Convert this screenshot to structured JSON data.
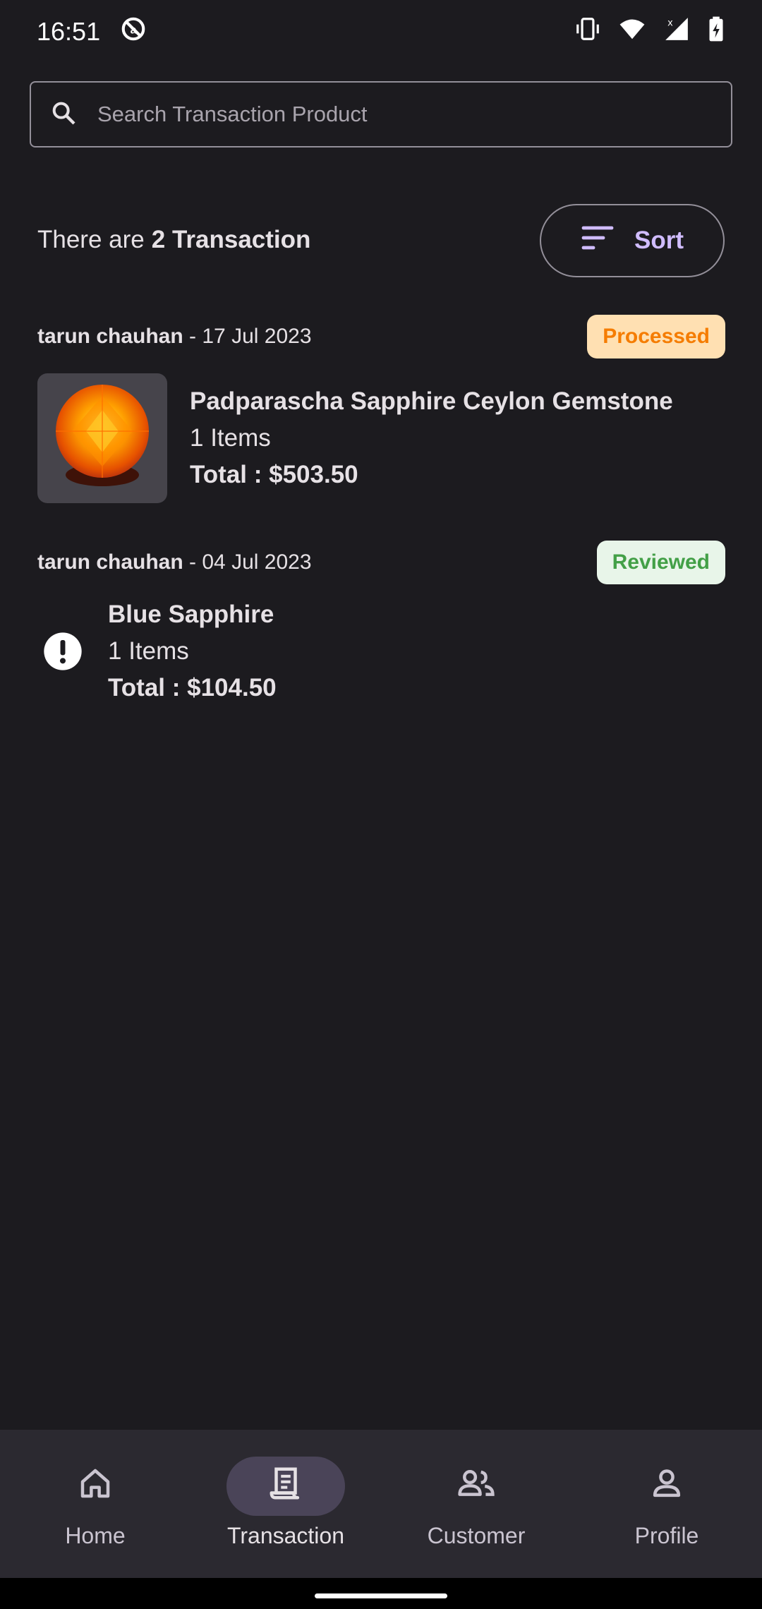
{
  "status_bar": {
    "time": "16:51"
  },
  "search": {
    "placeholder": "Search Transaction Product"
  },
  "summary": {
    "prefix": "There are",
    "count_text": "2 Transaction"
  },
  "sort": {
    "label": "Sort"
  },
  "transactions": [
    {
      "customer": "tarun chauhan",
      "separator": " - ",
      "date": "17 Jul 2023",
      "status": "Processed",
      "product": "Padparascha Sapphire Ceylon Gemstone",
      "items": "1 Items",
      "total": "Total : $503.50",
      "has_image": true
    },
    {
      "customer": "tarun chauhan",
      "separator": " - ",
      "date": "04 Jul 2023",
      "status": "Reviewed",
      "product": "Blue Sapphire",
      "items": "1 Items",
      "total": "Total : $104.50",
      "has_image": false
    }
  ],
  "nav": [
    {
      "label": "Home",
      "icon": "home-icon",
      "active": false
    },
    {
      "label": "Transaction",
      "icon": "receipt-icon",
      "active": true
    },
    {
      "label": "Customer",
      "icon": "people-icon",
      "active": false
    },
    {
      "label": "Profile",
      "icon": "person-icon",
      "active": false
    }
  ],
  "colors": {
    "background": "#1c1b1f",
    "accent": "#d0bcff",
    "processed_bg": "#ffe0b2",
    "processed_text": "#f57c00",
    "reviewed_bg": "#e8f5e9",
    "reviewed_text": "#43a047",
    "nav_bg": "#2b2930",
    "nav_active": "#4a4458"
  }
}
